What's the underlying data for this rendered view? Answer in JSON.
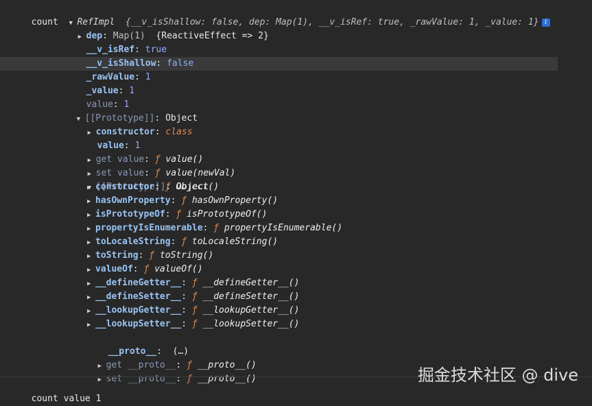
{
  "header": {
    "label": "count",
    "type": "RefImpl",
    "preview": "{__v_isShallow: false, dep: Map(1), __v_isRef: true, _rawValue: 1, _value: 1}"
  },
  "rows": {
    "dep_key": "dep",
    "dep_val": "Map(1)",
    "dep_preview": "{ReactiveEffect => 2}",
    "isref_key": "__v_isRef",
    "isref_val": "true",
    "isshallow_key": "__v_isShallow",
    "isshallow_val": "false",
    "rawvalue_key": "_rawValue",
    "rawvalue_val": "1",
    "value_key": "_value",
    "value_val": "1",
    "value2_key": "value",
    "value2_val": "1",
    "proto_key": "[[Prototype]]",
    "proto_val": "Object",
    "ctor_key": "constructor",
    "ctor_val": "class",
    "pvalue_key": "value",
    "pvalue_val": "1",
    "getvalue_key": "get value",
    "getvalue_val": "value()",
    "setvalue_key": "set value",
    "setvalue_val": "value(newVal)",
    "proto2_key": "[[Prototype]]",
    "proto2_val": "Object",
    "f_symbol": "ƒ",
    "ellipsis": "(…)"
  },
  "object_proto": [
    {
      "key": "constructor",
      "val": "Object()"
    },
    {
      "key": "hasOwnProperty",
      "val": "hasOwnProperty()"
    },
    {
      "key": "isPrototypeOf",
      "val": "isPrototypeOf()"
    },
    {
      "key": "propertyIsEnumerable",
      "val": "propertyIsEnumerable()"
    },
    {
      "key": "toLocaleString",
      "val": "toLocaleString()"
    },
    {
      "key": "toString",
      "val": "toString()"
    },
    {
      "key": "valueOf",
      "val": "valueOf()"
    },
    {
      "key": "__defineGetter__",
      "val": "__defineGetter__()"
    },
    {
      "key": "__defineSetter__",
      "val": "__defineSetter__()"
    },
    {
      "key": "__lookupGetter__",
      "val": "__lookupGetter__()"
    },
    {
      "key": "__lookupSetter__",
      "val": "__lookupSetter__()"
    }
  ],
  "proto_tail": {
    "proto_key": "__proto__",
    "get_key": "get __proto__",
    "get_val": "__proto__()",
    "set_key": "set __proto__",
    "set_val": "__proto__()"
  },
  "log": {
    "text": "count value 1"
  },
  "watermark": {
    "text": "掘金技术社区 @ dive"
  },
  "icons": {
    "expanded": "▼",
    "collapsed": "▶",
    "info": "i"
  }
}
